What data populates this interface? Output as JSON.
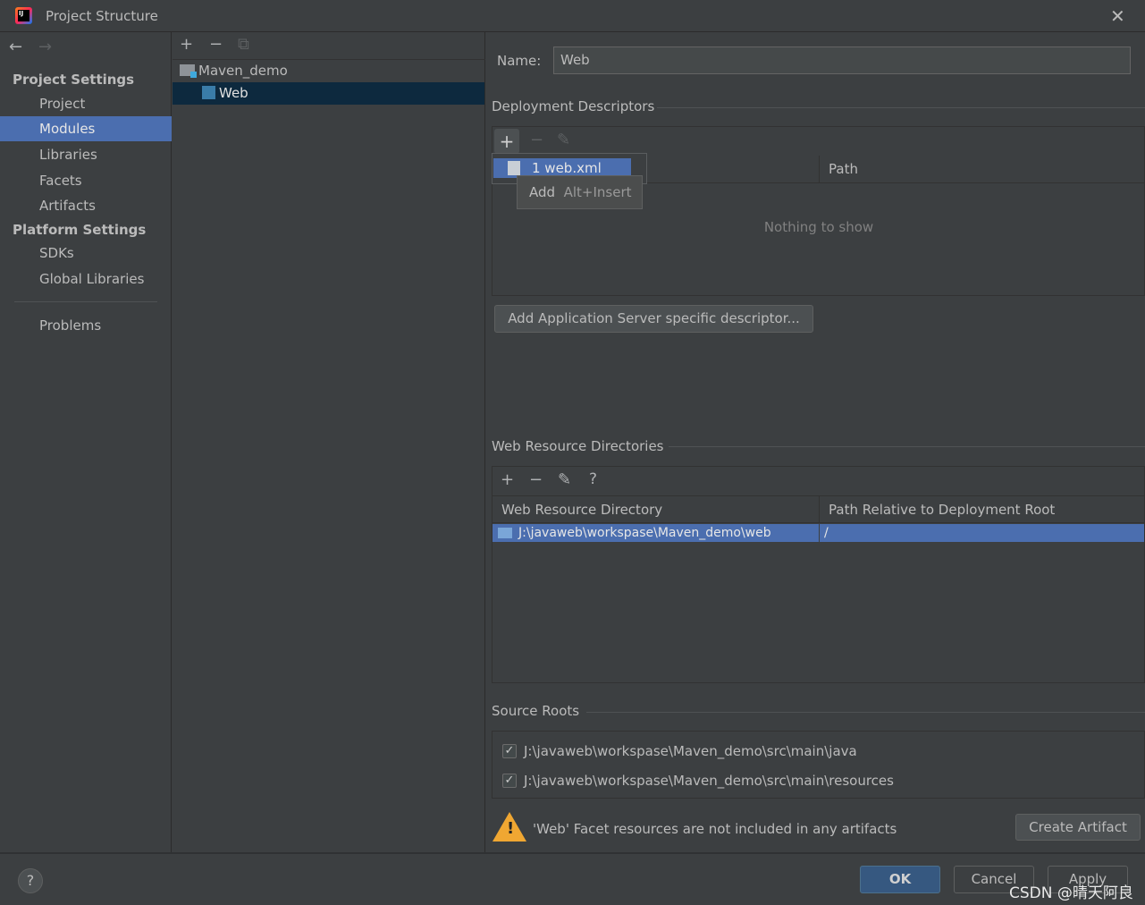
{
  "window": {
    "title": "Project Structure"
  },
  "sidebar": {
    "project_settings": "Project Settings",
    "items": [
      {
        "label": "Project"
      },
      {
        "label": "Modules"
      },
      {
        "label": "Libraries"
      },
      {
        "label": "Facets"
      },
      {
        "label": "Artifacts"
      }
    ],
    "platform_settings": "Platform Settings",
    "platform_items": [
      {
        "label": "SDKs"
      },
      {
        "label": "Global Libraries"
      }
    ],
    "problems": "Problems"
  },
  "tree": {
    "root": "Maven_demo",
    "child": "Web"
  },
  "details": {
    "name_label": "Name:",
    "name_value": "Web",
    "deployment_descriptors": "Deployment Descriptors",
    "descriptor_menu_item": "1  web.xml",
    "tooltip_add": "Add",
    "tooltip_shortcut": "Alt+Insert",
    "path_header": "Path",
    "empty_text": "Nothing to show",
    "add_server_descriptor": "Add Application Server specific descriptor...",
    "web_resource_dirs": "Web Resource Directories",
    "wrd_headers": [
      "Web Resource Directory",
      "Path Relative to Deployment Root"
    ],
    "wrd_rows": [
      {
        "dir": "J:\\javaweb\\workspase\\Maven_demo\\web",
        "path": "/"
      }
    ],
    "source_roots": "Source Roots",
    "source_root_items": [
      {
        "path": "J:\\javaweb\\workspase\\Maven_demo\\src\\main\\java",
        "checked": true
      },
      {
        "path": "J:\\javaweb\\workspase\\Maven_demo\\src\\main\\resources",
        "checked": true
      }
    ],
    "warning": "'Web' Facet resources are not included in any artifacts",
    "create_artifact": "Create Artifact"
  },
  "footer": {
    "ok": "OK",
    "cancel": "Cancel",
    "apply": "Apply",
    "watermark": "CSDN @晴天阿良"
  },
  "colors": {
    "selection": "#4b6eaf",
    "tree_selection": "#0d293e",
    "ok_button": "#365880"
  }
}
